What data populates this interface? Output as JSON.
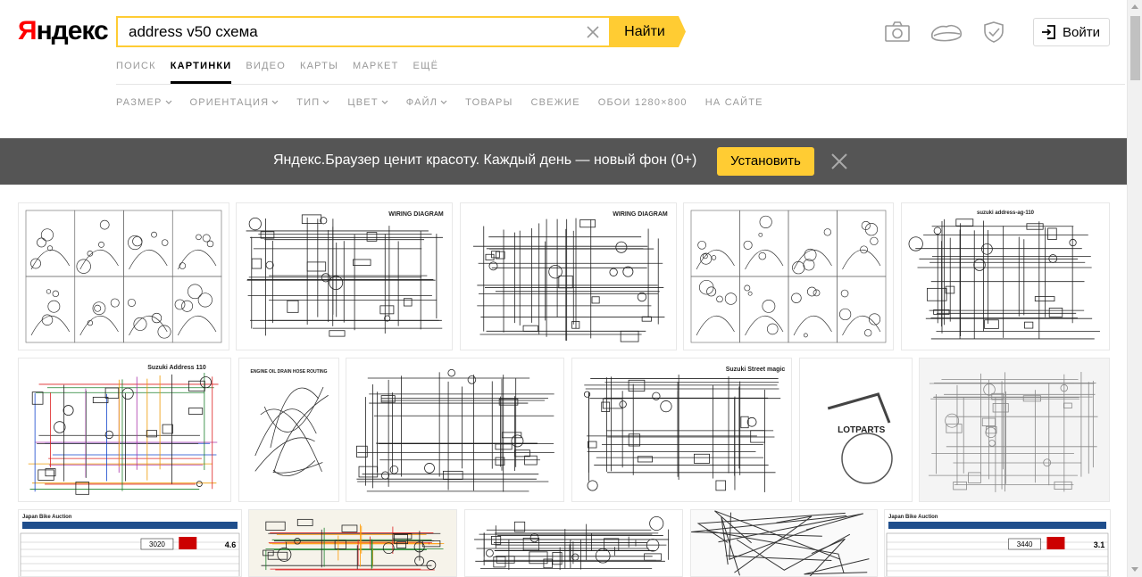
{
  "header": {
    "logo_first": "Я",
    "logo_rest": "ндекс",
    "search_value": "address v50 схема",
    "find_label": "Найти",
    "login_label": "Войти",
    "icons": [
      "camera-icon",
      "cloud-icon",
      "shield-icon"
    ]
  },
  "tabs": [
    {
      "label": "ПОИСК",
      "active": false
    },
    {
      "label": "КАРТИНКИ",
      "active": true
    },
    {
      "label": "ВИДЕО",
      "active": false
    },
    {
      "label": "КАРТЫ",
      "active": false
    },
    {
      "label": "МАРКЕТ",
      "active": false
    },
    {
      "label": "ЕЩЁ",
      "active": false
    }
  ],
  "filters": [
    {
      "label": "РАЗМЕР",
      "dropdown": true
    },
    {
      "label": "ОРИЕНТАЦИЯ",
      "dropdown": true
    },
    {
      "label": "ТИП",
      "dropdown": true
    },
    {
      "label": "ЦВЕТ",
      "dropdown": true
    },
    {
      "label": "ФАЙЛ",
      "dropdown": true
    },
    {
      "label": "ТОВАРЫ",
      "dropdown": false
    },
    {
      "label": "СВЕЖИЕ",
      "dropdown": false
    },
    {
      "label": "ОБОИ 1280×800",
      "dropdown": false
    },
    {
      "label": "НА САЙТЕ",
      "dropdown": false
    }
  ],
  "banner": {
    "text": "Яндекс.Браузер ценит красоту. Каждый день — новый фон (0+)",
    "install_label": "Установить"
  },
  "results": {
    "row1": [
      {
        "kind": "parts",
        "caption": ""
      },
      {
        "kind": "wiring",
        "caption": "WIRING DIAGRAM"
      },
      {
        "kind": "wiring",
        "caption": "WIRING DIAGRAM"
      },
      {
        "kind": "parts",
        "caption": ""
      },
      {
        "kind": "wiring-v",
        "caption": "suzuki address-ag-110"
      }
    ],
    "row2": [
      {
        "kind": "color-wiring",
        "caption": "Suzuki Address 110"
      },
      {
        "kind": "routing",
        "caption": "ENGINE OIL DRAIN HOSE ROUTING"
      },
      {
        "kind": "wiring",
        "caption": ""
      },
      {
        "kind": "wiring",
        "caption": "Suzuki Street magic"
      },
      {
        "kind": "part",
        "caption": "LOTPARTS"
      },
      {
        "kind": "wiring-gray",
        "caption": ""
      }
    ],
    "row3": [
      {
        "kind": "doc",
        "caption": "Japan Bike Auction",
        "value": "3020",
        "grade": "4.6"
      },
      {
        "kind": "color-wiring-2",
        "caption": ""
      },
      {
        "kind": "wiring",
        "caption": ""
      },
      {
        "kind": "engine",
        "caption": ""
      },
      {
        "kind": "doc",
        "caption": "Japan Bike Auction",
        "value": "3440",
        "grade": "3.1"
      }
    ]
  }
}
